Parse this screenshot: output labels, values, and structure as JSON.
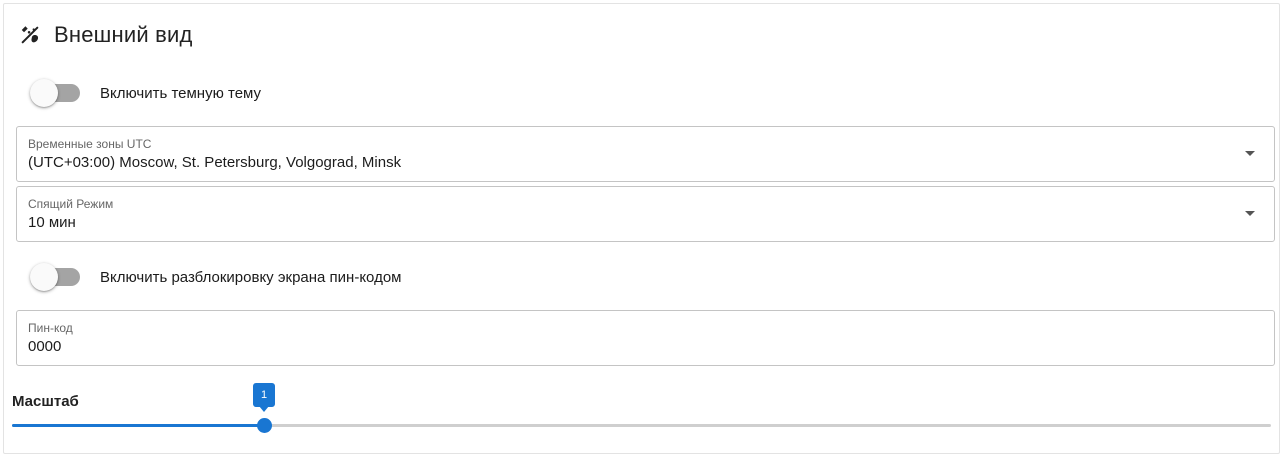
{
  "section": {
    "title": "Внешний вид",
    "icon": "palette-brush-icon"
  },
  "dark_theme": {
    "label": "Включить темную тему",
    "enabled": false
  },
  "timezone": {
    "label": "Временные зоны UTC",
    "value": "(UTC+03:00) Moscow, St. Petersburg, Volgograd, Minsk"
  },
  "sleep_mode": {
    "label": "Спящий Режим",
    "value": "10 мин"
  },
  "pin_unlock": {
    "label": "Включить разблокировку экрана пин-кодом",
    "enabled": false
  },
  "pin_code": {
    "label": "Пин-код",
    "value": "0000"
  },
  "scale": {
    "label": "Масштаб",
    "value": "1",
    "fraction": 0.2
  },
  "colors": {
    "accent": "#1976d2",
    "toggle_off_track": "#a4a4a4",
    "border": "#c4c4c4"
  }
}
